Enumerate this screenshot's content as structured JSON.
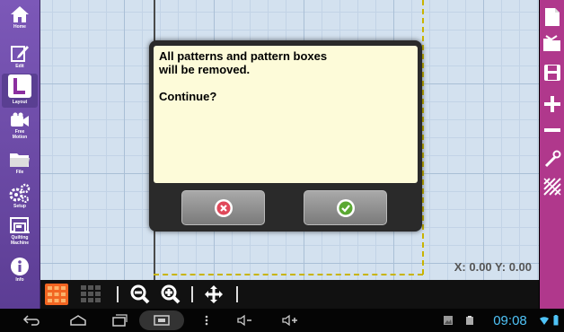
{
  "sidebar": {
    "items": [
      {
        "label": "Home",
        "icon": "home-icon"
      },
      {
        "label": "Edit",
        "icon": "pencil-icon"
      },
      {
        "label": "Layout",
        "icon": "layout-l-icon"
      },
      {
        "label": "Free\nMotion",
        "icon": "camera-icon"
      },
      {
        "label": "File",
        "icon": "folder-icon"
      },
      {
        "label": "Setup",
        "icon": "gears-icon"
      },
      {
        "label": "Quilting\nMachine",
        "icon": "sewing-machine-icon"
      },
      {
        "label": "Info",
        "icon": "info-icon"
      }
    ],
    "active": "Layout"
  },
  "dialog": {
    "line1": "All patterns and pattern boxes",
    "line2": "will be removed.",
    "line3": "Continue?",
    "cancel_icon": "cancel-x-icon",
    "ok_icon": "ok-check-icon"
  },
  "canvas": {
    "coords": "X: 0.00 Y: 0.00"
  },
  "right_toolbar": {
    "items": [
      "new-page-icon",
      "open-folder-icon",
      "save-icon",
      "plus-icon",
      "minus-icon",
      "tool-icon",
      "quilt-pattern-icon"
    ]
  },
  "bottom_toolbar": {
    "items": [
      "grid-on-icon",
      "grid-off-icon",
      "zoom-out-icon",
      "zoom-in-icon",
      "pan-move-icon"
    ]
  },
  "navbar": {
    "time": "09:08"
  },
  "colors": {
    "sidebar": "#6a4aa6",
    "right_toolbar": "#b0388c",
    "canvas_bg": "#d3e1ef",
    "grid_accent": "#f26522",
    "clock": "#4fc3f7"
  }
}
